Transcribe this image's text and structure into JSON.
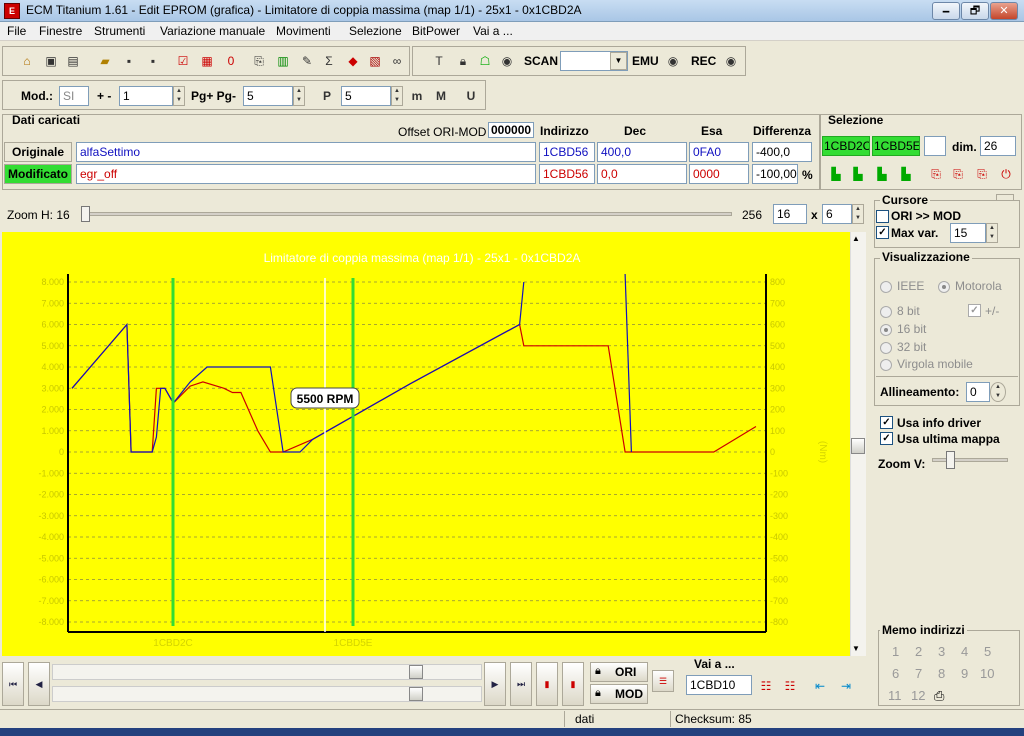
{
  "window": {
    "title": "ECM Titanium 1.61 - Edit EPROM (grafica) - Limitatore di coppia massima (map 1/1) - 25x1 - 0x1CBD2A",
    "min": "🗕",
    "max": "🗗",
    "close": "✕"
  },
  "menu": [
    "File",
    "Finestre",
    "Strumenti",
    "Variazione manuale",
    "Movimenti",
    "Selezione",
    "BitPower",
    "Vai a ..."
  ],
  "toolbar": {
    "scan_label": "SCAN",
    "scan_value": "",
    "emu_label": "EMU",
    "rec_label": "REC"
  },
  "toolbar2": {
    "mod_label": "Mod.:",
    "mod_value": "SI",
    "plusminus_label": "+ -",
    "plusminus_value": "1",
    "pg_label": "Pg+ Pg-",
    "pg_value": "5",
    "p_value": "5"
  },
  "dati": {
    "title": "Dati caricati",
    "offset_label": "Offset ORI-MOD",
    "offset_value": "000000",
    "col_indirizzo": "Indirizzo",
    "col_dec": "Dec",
    "col_esa": "Esa",
    "col_diff": "Differenza",
    "originale": {
      "label": "Originale",
      "name": "alfaSettimo",
      "indirizzo": "1CBD56",
      "dec": "400,0",
      "esa": "0FA0",
      "diff": "-400,0"
    },
    "modificato": {
      "label": "Modificato",
      "name": "egr_off",
      "indirizzo": "1CBD56",
      "dec": "0,0",
      "esa": "0000",
      "diff": "-100,00",
      "pct": "%"
    }
  },
  "selezione": {
    "title": "Selezione",
    "start": "1CBD2C",
    "end": "1CBD5E",
    "dim_label": "dim.",
    "dim_value": "26"
  },
  "zoom": {
    "label": "Zoom H: 16",
    "max": "256",
    "w": "16",
    "x": "x",
    "h": "6"
  },
  "cursore": {
    "title": "Cursore",
    "ori_mod": "ORI >> MOD",
    "max_var_label": "Max var.",
    "max_var_value": "15"
  },
  "visualizzazione": {
    "title": "Visualizzazione",
    "ieee": "IEEE",
    "motorola": "Motorola",
    "bit8": "8 bit",
    "bit16": "16 bit",
    "bit32": "32 bit",
    "virgola": "Virgola mobile",
    "plusminus": "+/-",
    "allineamento_label": "Allineamento:",
    "allineamento_value": "0",
    "usa_info": "Usa info driver",
    "usa_ultima": "Usa ultima mappa",
    "zoomv": "Zoom V:"
  },
  "memo": {
    "title": "Memo indirizzi",
    "items": [
      "1",
      "2",
      "3",
      "4",
      "5",
      "6",
      "7",
      "8",
      "9",
      "10",
      "11",
      "12"
    ]
  },
  "bottom": {
    "ori": "ORI",
    "mod": "MOD",
    "vai_label": "Vai a ...",
    "vai_value": "1CBD10"
  },
  "status": {
    "dati": "dati",
    "checksum": "Checksum: 85"
  },
  "chart_data": {
    "type": "line",
    "title": "Limitatore di coppia massima (map 1/1) - 25x1 - 0x1CBD2A",
    "y_left_ticks": [
      "8.000",
      "7.000",
      "6.000",
      "5.000",
      "4.000",
      "3.000",
      "2.000",
      "1.000",
      "0",
      "-1.000",
      "-2.000",
      "-3.000",
      "-4.000",
      "-5.000",
      "-6.000",
      "-7.000",
      "-8.000"
    ],
    "y_right_ticks": [
      "800",
      "700",
      "600",
      "500",
      "400",
      "300",
      "200",
      "100",
      "0",
      "-100",
      "-200",
      "-300",
      "-400",
      "-500",
      "-600",
      "-700",
      "-800"
    ],
    "y_right_label": "(Nm)",
    "ylim": [
      -8000,
      8000
    ],
    "cursor_label": "5500 RPM",
    "marker_left": "1CBD2C",
    "marker_right": "1CBD5E",
    "bg": "#ffff00",
    "series": [
      {
        "color": "#cc0000",
        "points": [
          [
            0,
            3000
          ],
          [
            13,
            6000
          ],
          [
            14,
            0
          ],
          [
            19,
            0
          ],
          [
            20,
            3000
          ],
          [
            22,
            3000
          ],
          [
            24,
            2300
          ],
          [
            28,
            3100
          ],
          [
            31,
            3300
          ],
          [
            36,
            3000
          ],
          [
            38,
            2800
          ],
          [
            40,
            2800
          ],
          [
            44,
            1000
          ],
          [
            47,
            0
          ],
          [
            50,
            0
          ],
          [
            57,
            600
          ],
          [
            80,
            3200
          ],
          [
            106,
            6000
          ],
          [
            107,
            5000
          ],
          [
            127,
            5000
          ],
          [
            131,
            0
          ],
          [
            152,
            0
          ],
          [
            162,
            1200
          ]
        ]
      },
      {
        "color": "#1010c0",
        "points": [
          [
            0,
            3000
          ],
          [
            13,
            6000
          ],
          [
            14,
            0
          ],
          [
            19,
            0
          ],
          [
            20,
            700
          ],
          [
            21,
            3000
          ],
          [
            22,
            3000
          ],
          [
            24,
            2300
          ],
          [
            28,
            3300
          ],
          [
            32,
            4000
          ],
          [
            47,
            4000
          ],
          [
            50,
            0
          ],
          [
            54,
            0
          ],
          [
            57,
            600
          ],
          [
            80,
            3200
          ],
          [
            106,
            6000
          ],
          [
            107,
            8000
          ]
        ]
      }
    ]
  }
}
